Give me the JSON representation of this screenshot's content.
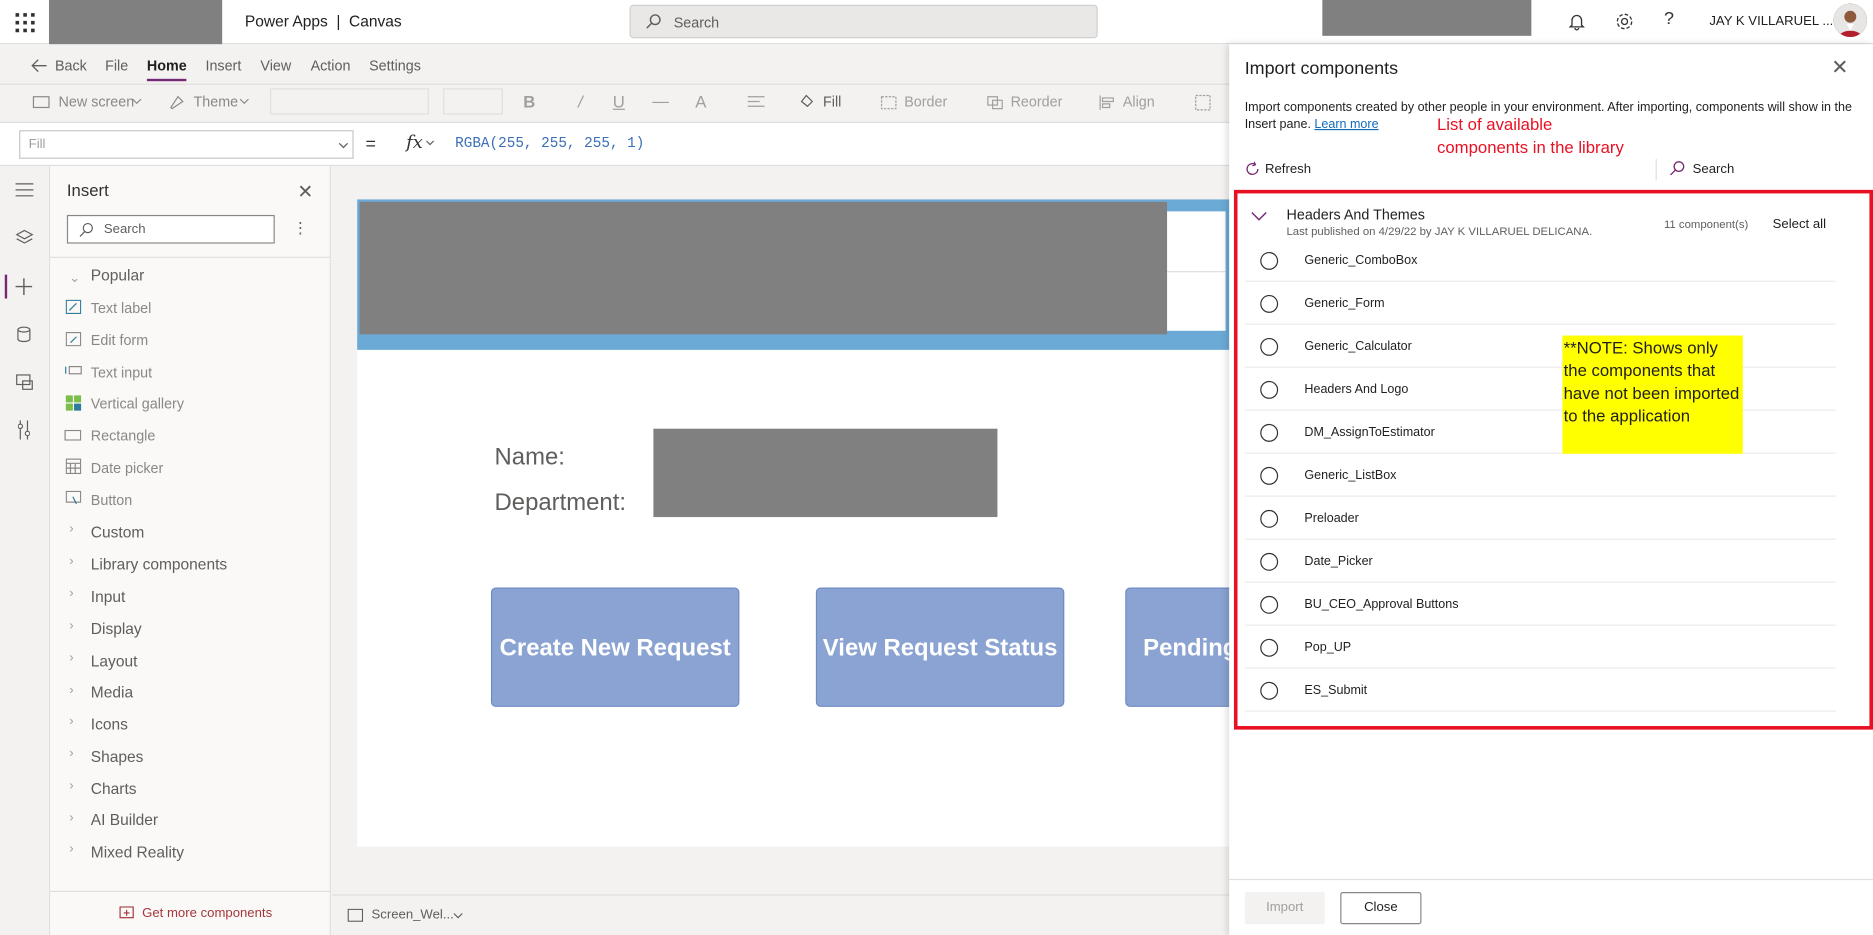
{
  "header": {
    "app_name": "Power Apps  |  Canvas",
    "search_placeholder": "Search",
    "help": "?",
    "user": "JAY K VILLARUEL ..."
  },
  "menu": {
    "back": "Back",
    "items": [
      "File",
      "Home",
      "Insert",
      "View",
      "Action",
      "Settings"
    ]
  },
  "toolbar": {
    "new_screen": "New screen",
    "theme": "Theme",
    "fill": "Fill",
    "border": "Border",
    "reorder": "Reorder",
    "align": "Align"
  },
  "formula_bar": {
    "property": "Fill",
    "equals": "=",
    "fx": "fx",
    "formula": "RGBA(255, 255, 255, 1)"
  },
  "insert_pane": {
    "title": "Insert",
    "search_placeholder": "Search",
    "popular_label": "Popular",
    "popular_items": [
      "Text label",
      "Edit form",
      "Text input",
      "Vertical gallery",
      "Rectangle",
      "Date picker",
      "Button"
    ],
    "categories": [
      "Custom",
      "Library components",
      "Input",
      "Display",
      "Layout",
      "Media",
      "Icons",
      "Shapes",
      "Charts",
      "AI Builder",
      "Mixed Reality"
    ],
    "get_more": "Get more components"
  },
  "canvas": {
    "name_label": "Name:",
    "dept_label": "Department:",
    "buttons": [
      "Create New Request",
      "View Request Status",
      "Pending"
    ],
    "screen_name": "Screen_Wel..."
  },
  "import_panel": {
    "title": "Import components",
    "description": "Import components created by other people in your environment. After importing, components will show in the Insert pane.",
    "learn_more": "Learn more",
    "refresh": "Refresh",
    "search": "Search",
    "group_title": "Headers And Themes",
    "group_subtitle": "Last published on 4/29/22 by JAY K VILLARUEL DELICANA.",
    "group_count": "11 component(s)",
    "select_all": "Select all",
    "components": [
      "Generic_ComboBox",
      "Generic_Form",
      "Generic_Calculator",
      "Headers And Logo",
      "DM_AssignToEstimator",
      "Generic_ListBox",
      "Preloader",
      "Date_Picker",
      "BU_CEO_Approval Buttons",
      "Pop_UP",
      "ES_Submit"
    ],
    "import_button": "Import",
    "close_button": "Close"
  },
  "annotations": {
    "list_note": "List of available components in the library",
    "yellow_note": "**NOTE: Shows only the components that have not been imported to the application"
  },
  "colors": {
    "accent": "#742774",
    "annotation_red": "#e81123",
    "note_yellow": "#ffff00",
    "canvas_button": "#8aa3d2",
    "banner": "#6baad6"
  }
}
